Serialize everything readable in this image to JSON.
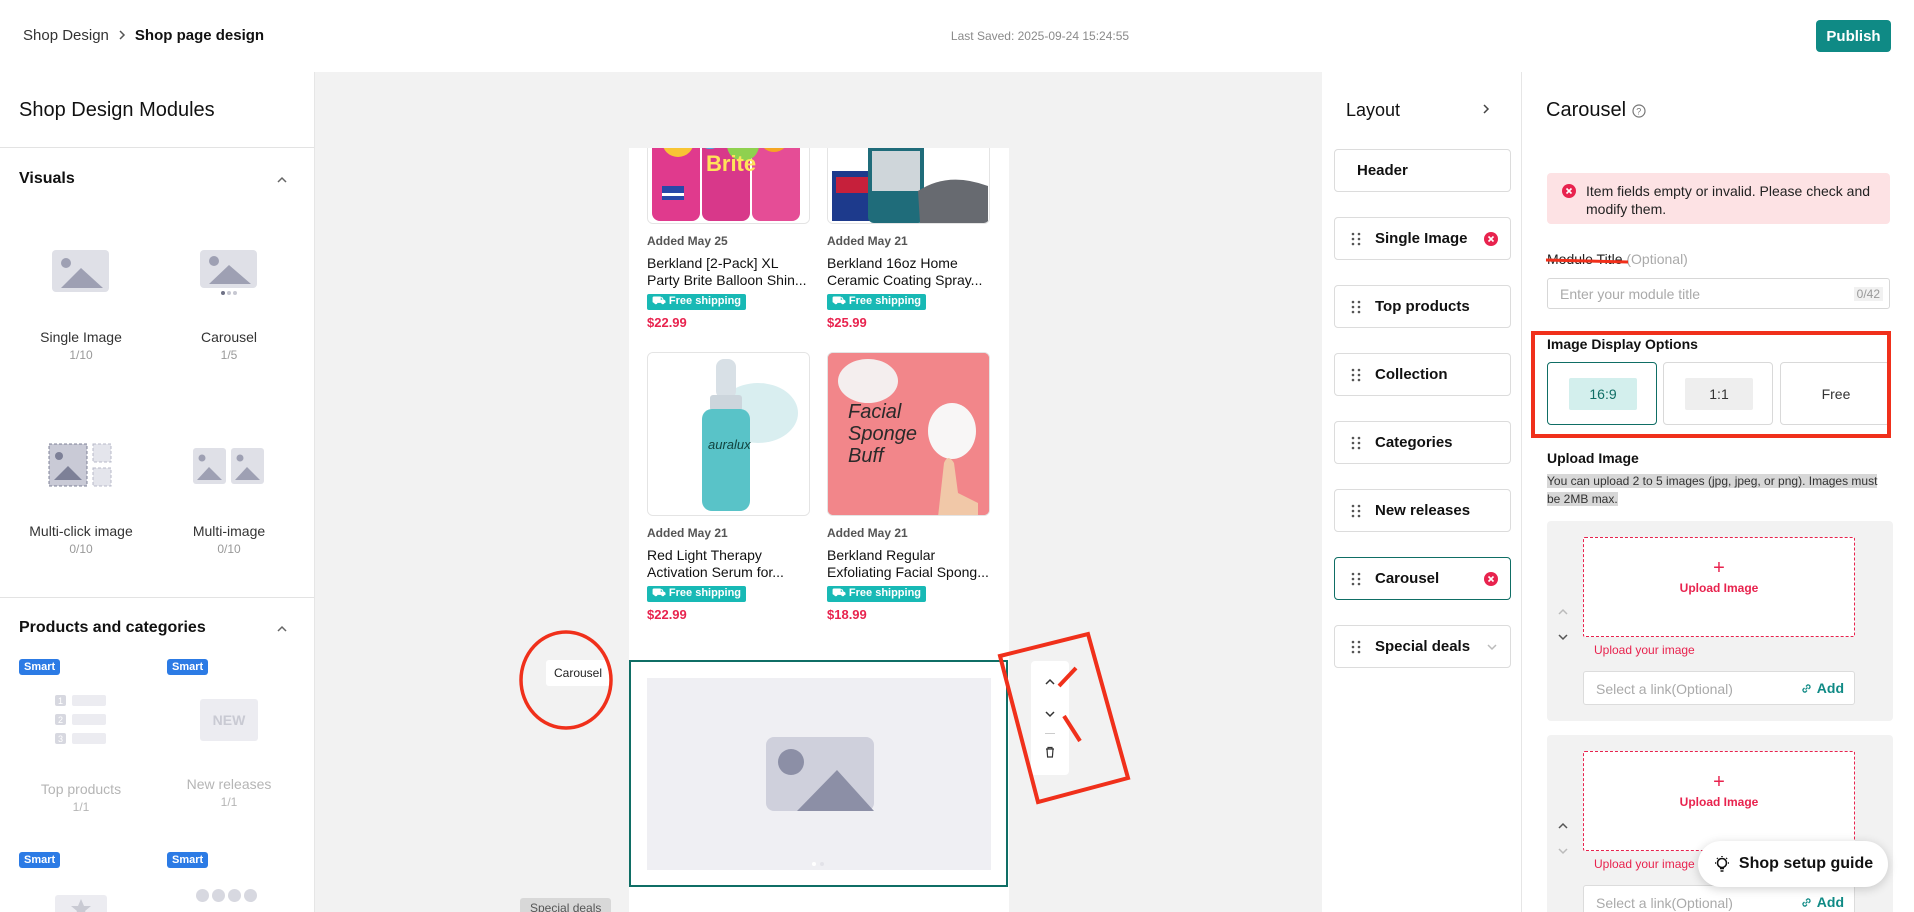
{
  "breadcrumb": {
    "parent": "Shop Design",
    "current": "Shop page design"
  },
  "last_saved": "Last Saved: 2025-09-24 15:24:55",
  "publish_label": "Publish",
  "modules_panel": {
    "title": "Shop Design Modules",
    "visuals": {
      "heading": "Visuals",
      "items": [
        {
          "name": "Single Image",
          "count": "1/10"
        },
        {
          "name": "Carousel",
          "count": "1/5"
        },
        {
          "name": "Multi-click image",
          "count": "0/10"
        },
        {
          "name": "Multi-image",
          "count": "0/10"
        }
      ]
    },
    "products": {
      "heading": "Products and categories",
      "items": [
        {
          "name": "Top products",
          "count": "1/1",
          "badge": "Smart"
        },
        {
          "name": "New releases",
          "count": "1/1",
          "badge": "Smart",
          "thumb_text": "NEW"
        }
      ],
      "more_badges": [
        "Smart",
        "Smart"
      ]
    }
  },
  "canvas": {
    "products": [
      {
        "added": "Added May 25",
        "name": "Berkland [2-Pack] XL Party Brite Balloon Shin...",
        "shipping": "Free shipping",
        "price": "$22.99",
        "image": "balloon-spray-cans"
      },
      {
        "added": "Added May 21",
        "name": "Berkland 16oz Home Ceramic Coating Spray...",
        "shipping": "Free shipping",
        "price": "$25.99",
        "image": "ceramic-coating-spray"
      },
      {
        "added": "Added May 21",
        "name": "Red Light Therapy Activation Serum for...",
        "shipping": "Free shipping",
        "price": "$22.99",
        "image": "serum-bottle",
        "image_text": "auralux"
      },
      {
        "added": "Added May 21",
        "name": "Berkland Regular Exfoliating Facial Spong...",
        "shipping": "Free shipping",
        "price": "$18.99",
        "image": "facial-sponge-box",
        "image_text": "Facial Sponge Buff"
      }
    ],
    "selected_module_tag": "Carousel",
    "next_module_tag": "Special deals"
  },
  "layout_panel": {
    "title": "Layout",
    "items": [
      {
        "label": "Header",
        "error": false,
        "grip": false
      },
      {
        "label": "Single Image",
        "error": true,
        "grip": true
      },
      {
        "label": "Top products",
        "error": false,
        "grip": true
      },
      {
        "label": "Collection",
        "error": false,
        "grip": true
      },
      {
        "label": "Categories",
        "error": false,
        "grip": true
      },
      {
        "label": "New releases",
        "error": false,
        "grip": true
      },
      {
        "label": "Carousel",
        "error": true,
        "grip": true,
        "active": true
      },
      {
        "label": "Special deals",
        "error": false,
        "grip": true
      }
    ]
  },
  "settings": {
    "title": "Carousel",
    "error_message": "Item fields empty or invalid. Please check and modify them.",
    "module_title_label": "Module Title",
    "module_title_optional": "(Optional)",
    "module_title_placeholder": "Enter your module title",
    "module_title_counter": "0/42",
    "display_options_label": "Image Display Options",
    "display_options": [
      "16:9",
      "1:1",
      "Free"
    ],
    "display_selected": "16:9",
    "upload_label": "Upload Image",
    "upload_hint": "You can upload 2 to 5 images (jpg, jpeg, or png). Images must be 2MB max.",
    "slots": [
      {
        "button": "Upload Image",
        "error": "Upload your image",
        "link_placeholder": "Select a link(Optional)",
        "add_label": "Add"
      },
      {
        "button": "Upload Image",
        "error": "Upload your image",
        "link_placeholder": "Select a link(Optional)",
        "add_label": "Add"
      }
    ]
  },
  "guide_label": "Shop setup guide",
  "colors": {
    "accent": "#0f8a85",
    "error": "#e8234e",
    "annotation": "#f0301b",
    "smart_badge": "#2c7be5"
  }
}
